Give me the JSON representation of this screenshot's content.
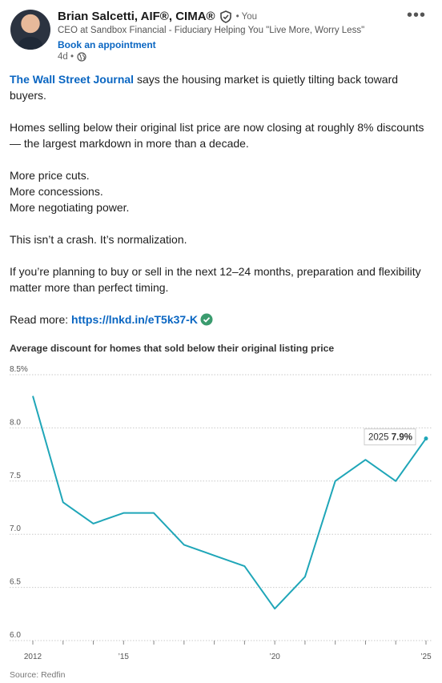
{
  "author": {
    "name": "Brian Salcetti, AIF®, CIMA®",
    "you_label": "• You",
    "headline": "CEO at Sandbox Financial - Fiduciary Helping You \"Live More, Worry Less\"",
    "appointment_link": "Book an appointment",
    "time": "4d •"
  },
  "post": {
    "source_link": "The Wall Street Journal",
    "p1_rest": " says the housing market is quietly tilting back toward buyers.",
    "p2": "Homes selling below their original list price are now closing at roughly 8% discounts — the largest markdown in more than a decade.",
    "p3a": "More price cuts.",
    "p3b": "More concessions.",
    "p3c": "More negotiating power.",
    "p4": "This isn’t a crash. It’s normalization.",
    "p5": "If you’re planning to buy or sell in the next 12–24 months, preparation and flexibility matter more than perfect timing.",
    "read_more_label": "Read more: ",
    "read_more_link": "https://lnkd.in/eT5k37-K"
  },
  "chart_data": {
    "type": "line",
    "title": "Average discount for homes that sold below their original listing price",
    "source": "Source: Redfin",
    "x": [
      2012,
      2013,
      2014,
      2015,
      2016,
      2017,
      2018,
      2019,
      2020,
      2021,
      2022,
      2023,
      2024,
      2025
    ],
    "series": [
      {
        "values": [
          8.3,
          7.3,
          7.1,
          7.2,
          7.2,
          6.9,
          6.8,
          6.7,
          6.3,
          6.6,
          7.5,
          7.7,
          7.5,
          7.9
        ]
      }
    ],
    "ylim": [
      6.0,
      8.5
    ],
    "y_ticks": [
      "8.5%",
      "8.0",
      "7.5",
      "7.0",
      "6.5",
      "6.0"
    ],
    "x_ticks": [
      {
        "x": 2012,
        "label": "2012"
      },
      {
        "x": 2015,
        "label": "’15"
      },
      {
        "x": 2020,
        "label": "’20"
      },
      {
        "x": 2025,
        "label": "’25"
      }
    ],
    "callout": {
      "year": "2025",
      "value": "7.9%"
    },
    "line_color": "#1fa6b8",
    "grid": true
  }
}
